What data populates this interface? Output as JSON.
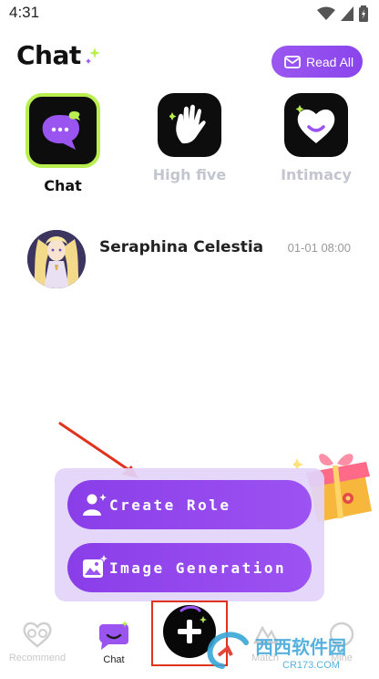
{
  "status_bar": {
    "time": "4:31"
  },
  "header": {
    "title": "Chat",
    "read_all_label": "Read All"
  },
  "categories": [
    {
      "label": "Chat",
      "icon": "chat-bubble-icon",
      "selected": true
    },
    {
      "label": "High five",
      "icon": "high-five-hand-icon",
      "selected": false
    },
    {
      "label": "Intimacy",
      "icon": "heart-icon",
      "selected": false
    }
  ],
  "conversations": [
    {
      "name": "Seraphina Celestia",
      "time": "01-01 08:00",
      "avatar": "anime-character-avatar"
    }
  ],
  "popup_menu": {
    "items": [
      {
        "label": "Create Role",
        "icon": "add-user-icon"
      },
      {
        "label": "Image Generation",
        "icon": "image-sparkle-icon"
      }
    ]
  },
  "bottom_nav": {
    "items": [
      {
        "label": "Recommend",
        "icon": "heart-glasses-icon",
        "active": false
      },
      {
        "label": "Chat",
        "icon": "chat-icon",
        "active": true
      },
      {
        "label": "Match",
        "icon": "match-icon",
        "active": false
      },
      {
        "label": "Mine",
        "icon": "profile-icon",
        "active": false
      }
    ]
  },
  "watermark": {
    "brand": "西西软件园",
    "domain": "CR173.COM"
  },
  "colors": {
    "accent": "#9a54f0",
    "selected_border": "#b8ef4f",
    "dim_label": "#c3c6cf",
    "annotation_red": "#e0331d"
  }
}
